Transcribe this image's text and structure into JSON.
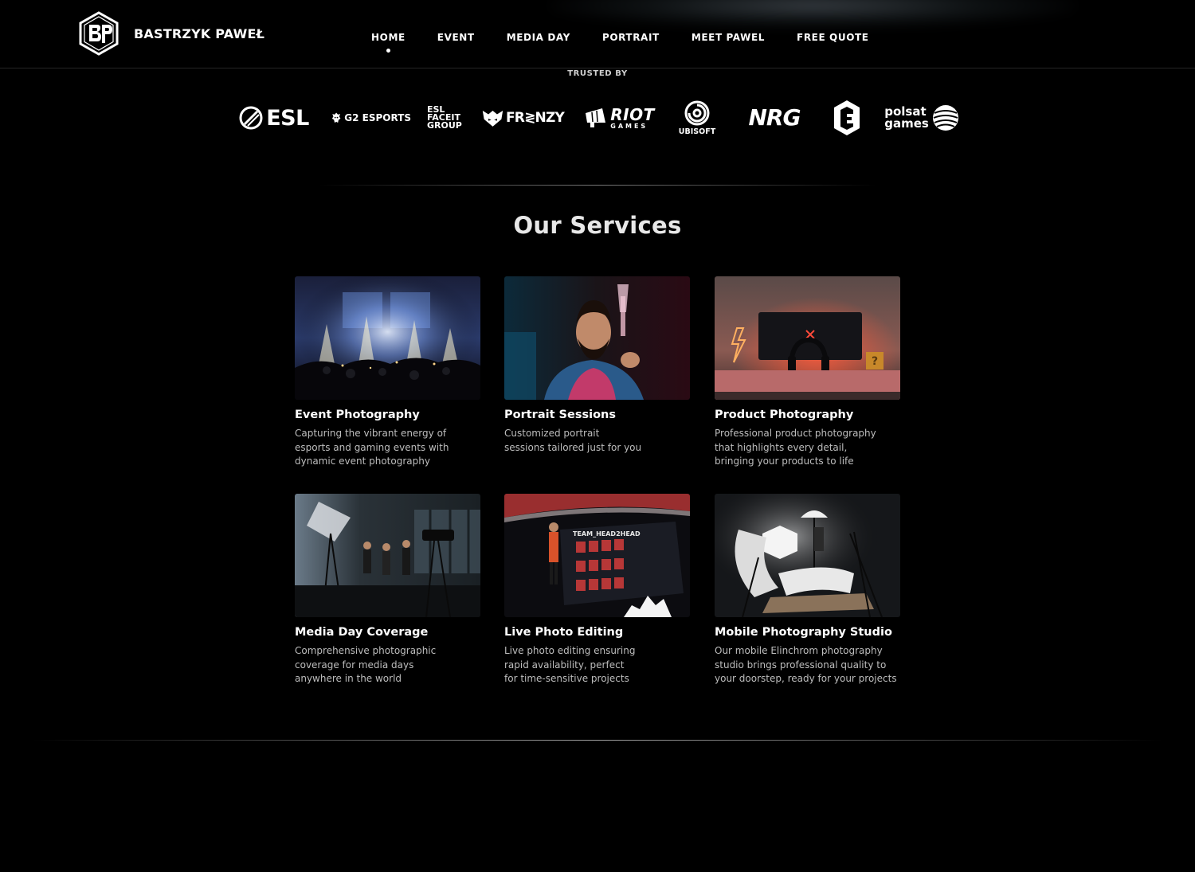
{
  "header": {
    "brand_name": "BASTRZYK PAWEŁ",
    "logo_icon": "bp-hexagon-logo-icon",
    "nav": [
      {
        "label": "HOME",
        "active": true
      },
      {
        "label": "EVENT",
        "active": false
      },
      {
        "label": "MEDIA DAY",
        "active": false
      },
      {
        "label": "PORTRAIT",
        "active": false
      },
      {
        "label": "MEET PAWEL",
        "active": false
      },
      {
        "label": "FREE QUOTE",
        "active": false
      }
    ]
  },
  "trusted": {
    "label": "TRUSTED BY",
    "logos": [
      {
        "name": "esl-logo",
        "text": "ESL"
      },
      {
        "name": "g2-esports-logo",
        "text": "G2 ESPORTS"
      },
      {
        "name": "esl-faceit-group-logo",
        "lines": [
          "ESL",
          "FACEIT",
          "GROUP"
        ]
      },
      {
        "name": "frenzy-logo",
        "text": "FR≷NZY"
      },
      {
        "name": "riot-games-logo",
        "lines": [
          "RIOT",
          "GAMES"
        ]
      },
      {
        "name": "ubisoft-logo",
        "text": "UBISOFT"
      },
      {
        "name": "nrg-logo",
        "text": "NRG"
      },
      {
        "name": "evil-geniuses-logo",
        "text": ""
      },
      {
        "name": "polsat-games-logo",
        "lines": [
          "polsat",
          "games"
        ]
      }
    ]
  },
  "services": {
    "title": "Our Services",
    "items": [
      {
        "title": "Event Photography",
        "description": "Capturing the vibrant energy of\nesports and gaming events with\ndynamic event photography"
      },
      {
        "title": "Portrait Sessions",
        "description": "Customized portrait\nsessions tailored just for you"
      },
      {
        "title": "Product Photography",
        "description": "Professional product photography\nthat highlights every detail,\nbringing your products to life"
      },
      {
        "title": "Media Day Coverage",
        "description": "Comprehensive photographic\ncoverage for media days\nanywhere in the world"
      },
      {
        "title": "Live Photo Editing",
        "description": "Live photo editing ensuring\nrapid availability, perfect\nfor time-sensitive projects"
      },
      {
        "title": "Mobile Photography Studio",
        "description": "Our mobile Elinchrom photography\nstudio brings professional quality to\nyour doorstep, ready for your projects"
      }
    ]
  },
  "image_overlays": {
    "team_screen": "TEAM_HEAD2HEAD"
  },
  "colors": {
    "background": "#000000",
    "text": "#ffffff",
    "muted_text": "#bdbdbd",
    "divider": "#aaaaaa"
  }
}
